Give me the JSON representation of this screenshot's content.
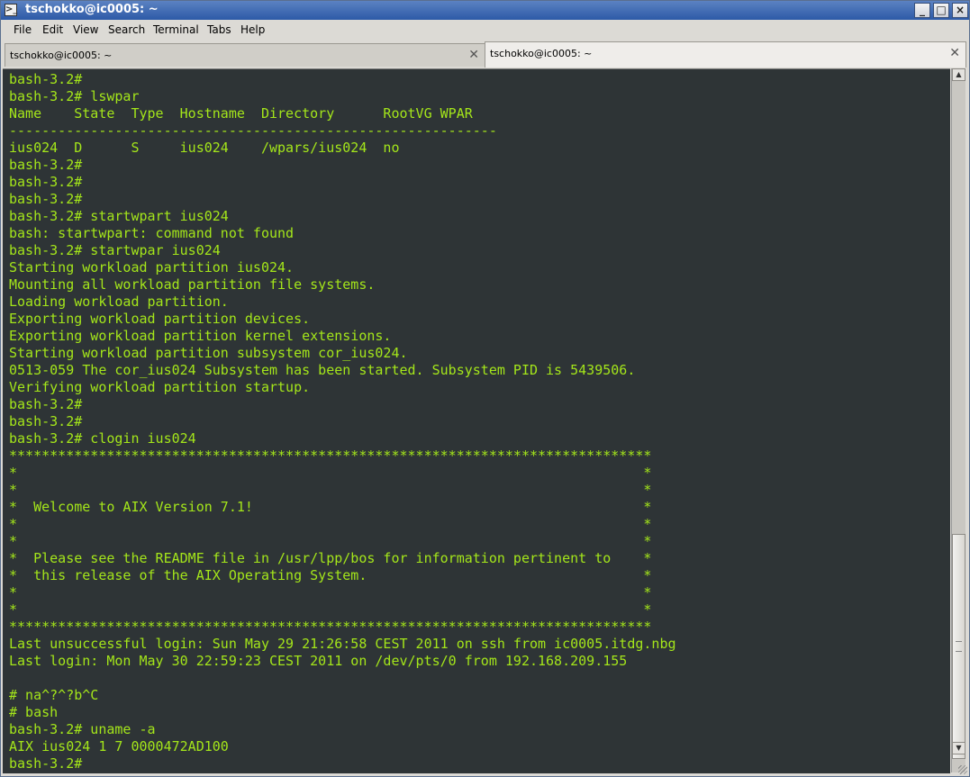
{
  "window": {
    "title": "tschokko@ic0005: ~",
    "buttons": {
      "minimize": "_",
      "maximize": "□",
      "close": "×"
    }
  },
  "menubar": {
    "items": [
      "File",
      "Edit",
      "View",
      "Search",
      "Terminal",
      "Tabs",
      "Help"
    ]
  },
  "tabs": [
    {
      "label": "tschokko@ic0005: ~",
      "active": false
    },
    {
      "label": "tschokko@ic0005: ~",
      "active": true
    }
  ],
  "terminal": {
    "colors": {
      "background": "#2e3436",
      "foreground": "#a4e61a"
    },
    "lines": [
      "bash-3.2#",
      "bash-3.2# lswpar",
      "Name    State  Type  Hostname  Directory      RootVG WPAR",
      "------------------------------------------------------------",
      "ius024  D      S     ius024    /wpars/ius024  no",
      "bash-3.2#",
      "bash-3.2#",
      "bash-3.2#",
      "bash-3.2# startwpart ius024",
      "bash: startwpart: command not found",
      "bash-3.2# startwpar ius024",
      "Starting workload partition ius024.",
      "Mounting all workload partition file systems.",
      "Loading workload partition.",
      "Exporting workload partition devices.",
      "Exporting workload partition kernel extensions.",
      "Starting workload partition subsystem cor_ius024.",
      "0513-059 The cor_ius024 Subsystem has been started. Subsystem PID is 5439506.",
      "Verifying workload partition startup.",
      "bash-3.2#",
      "bash-3.2#",
      "bash-3.2# clogin ius024",
      "*******************************************************************************",
      "*                                                                             *",
      "*                                                                             *",
      "*  Welcome to AIX Version 7.1!                                                *",
      "*                                                                             *",
      "*                                                                             *",
      "*  Please see the README file in /usr/lpp/bos for information pertinent to    *",
      "*  this release of the AIX Operating System.                                  *",
      "*                                                                             *",
      "*                                                                             *",
      "*******************************************************************************",
      "Last unsuccessful login: Sun May 29 21:26:58 CEST 2011 on ssh from ic0005.itdg.nbg",
      "Last login: Mon May 30 22:59:23 CEST 2011 on /dev/pts/0 from 192.168.209.155",
      "",
      "# na^?^?b^C",
      "# bash",
      "bash-3.2# uname -a",
      "AIX ius024 1 7 0000472AD100",
      "bash-3.2#"
    ]
  },
  "scrollbar": {
    "up_arrow": "▲",
    "down_arrow": "▼",
    "position": 0.66
  }
}
